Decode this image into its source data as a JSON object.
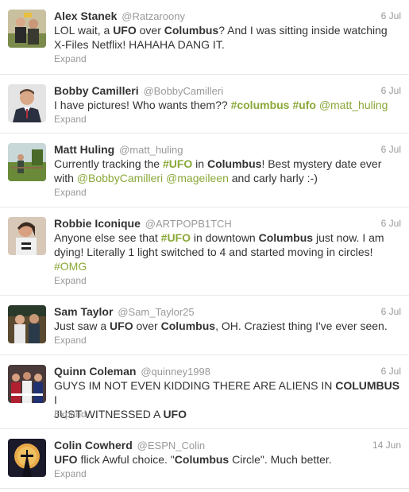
{
  "tweets": [
    {
      "name": "Alex Stanek",
      "handle": "@Ratzaroony",
      "date": "6 Jul",
      "avatar_icon": "profile-photo-sports-fans",
      "lines": [
        [
          {
            "t": "LOL wait, a "
          },
          {
            "t": "UFO",
            "b": true
          },
          {
            "t": " over "
          },
          {
            "t": "Columbus",
            "b": true
          },
          {
            "t": "? And I was sitting inside watching"
          }
        ],
        [
          {
            "t": "X-Files Netflix! HAHAHA DANG IT."
          }
        ]
      ],
      "expand": "Expand"
    },
    {
      "name": "Bobby Camilleri",
      "handle": "@BobbyCamilleri",
      "date": "6 Jul",
      "avatar_icon": "profile-photo-man-in-suit",
      "lines": [
        [
          {
            "t": "I have pictures! Who wants them?? "
          },
          {
            "t": "#columbus",
            "link": true,
            "b": true
          },
          {
            "t": " "
          },
          {
            "t": "#ufo",
            "link": true,
            "b": true
          },
          {
            "t": " "
          },
          {
            "t": "@matt_huling",
            "link": true
          }
        ]
      ],
      "expand": "Expand"
    },
    {
      "name": "Matt Huling",
      "handle": "@matt_huling",
      "date": "6 Jul",
      "avatar_icon": "profile-photo-outdoors",
      "lines": [
        [
          {
            "t": "Currently tracking the "
          },
          {
            "t": "#UFO",
            "link": true,
            "b": true
          },
          {
            "t": " in "
          },
          {
            "t": "Columbus",
            "b": true
          },
          {
            "t": "! Best mystery date ever"
          }
        ],
        [
          {
            "t": "with "
          },
          {
            "t": "@BobbyCamilleri",
            "link": true
          },
          {
            "t": " "
          },
          {
            "t": "@mageileen",
            "link": true
          },
          {
            "t": " and carly harly :-)"
          }
        ]
      ],
      "expand": "Expand"
    },
    {
      "name": "Robbie Iconique",
      "handle": "@ARTPOPB1TCH",
      "date": "6 Jul",
      "avatar_icon": "profile-photo-selfie",
      "lines": [
        [
          {
            "t": "Anyone else see that "
          },
          {
            "t": "#UFO",
            "link": true,
            "b": true
          },
          {
            "t": " in downtown "
          },
          {
            "t": "Columbus",
            "b": true
          },
          {
            "t": " just now. I am"
          }
        ],
        [
          {
            "t": "dying! Literally 1 light switched to 4 and started moving in circles!"
          }
        ],
        [
          {
            "t": "#OMG",
            "link": true
          }
        ]
      ],
      "expand": "Expand"
    },
    {
      "name": "Sam Taylor",
      "handle": "@Sam_Taylor25",
      "date": "6 Jul",
      "avatar_icon": "profile-photo-two-friends",
      "lines": [
        [
          {
            "t": "Just saw a "
          },
          {
            "t": "UFO",
            "b": true
          },
          {
            "t": " over "
          },
          {
            "t": "Columbus",
            "b": true
          },
          {
            "t": ", OH. Craziest thing I've ever seen."
          }
        ]
      ],
      "expand": "Expand"
    },
    {
      "name": "Quinn Coleman",
      "handle": "@quinney1998",
      "date": "6 Jul",
      "avatar_icon": "profile-photo-group",
      "lines": [
        [
          {
            "t": "GUYS IM NOT EVEN KIDDING THERE ARE ALIENS IN "
          },
          {
            "t": "COLUMBUS",
            "b": true
          },
          {
            "t": " I"
          }
        ],
        [
          {
            "t": "JUST WITNESSED A "
          },
          {
            "t": "UFO",
            "b": true
          }
        ]
      ],
      "expand": "Expand"
    },
    {
      "name": "Colin Cowherd",
      "handle": "@ESPN_Colin",
      "date": "14 Jun",
      "avatar_icon": "profile-photo-space-needle-moon",
      "lines": [
        [
          {
            "t": "UFO",
            "b": true
          },
          {
            "t": " flick Awful choice.  \""
          },
          {
            "t": "Columbus",
            "b": true
          },
          {
            "t": " Circle\". Much better."
          }
        ]
      ],
      "expand": "Expand"
    }
  ],
  "colors": {
    "hashtag": "#8aa838",
    "meta": "#999999",
    "text": "#333333",
    "divider": "#e8e8e8"
  }
}
